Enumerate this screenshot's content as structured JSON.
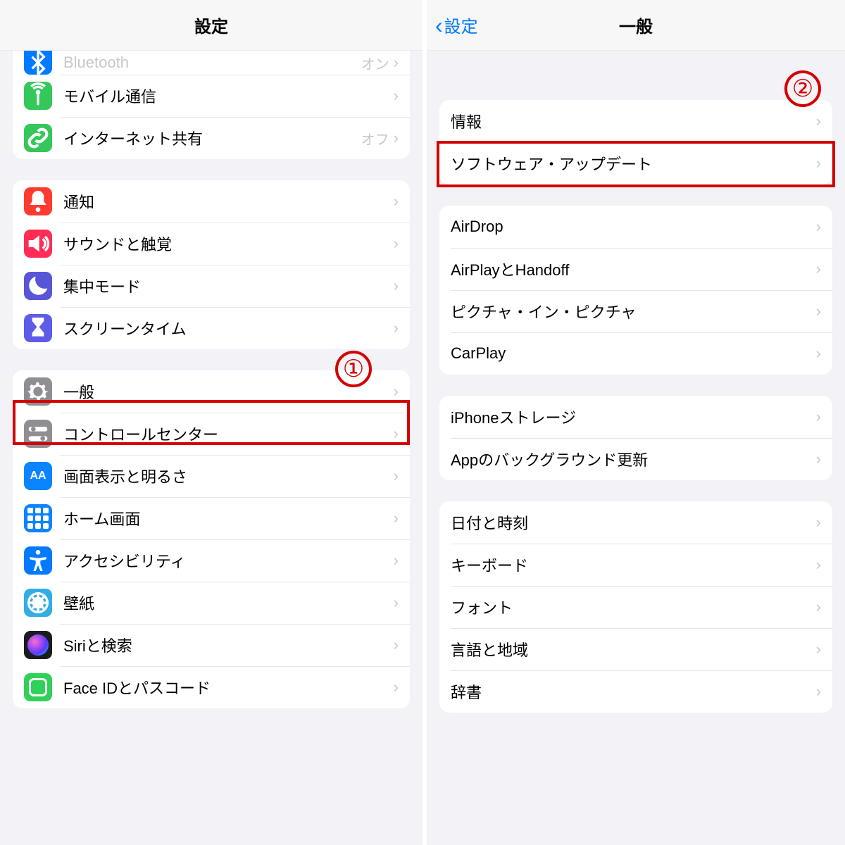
{
  "left": {
    "title": "設定",
    "step_badge": "①",
    "groups": [
      {
        "rows": [
          {
            "icon": "bluetooth-icon",
            "iconClass": "ic-blue",
            "label": "Bluetooth",
            "detail": "オン"
          },
          {
            "icon": "antenna-icon",
            "iconClass": "ic-green",
            "label": "モバイル通信",
            "detail": ""
          },
          {
            "icon": "link-icon",
            "iconClass": "ic-green",
            "label": "インターネット共有",
            "detail": "オフ"
          }
        ]
      },
      {
        "rows": [
          {
            "icon": "bell-icon",
            "iconClass": "ic-red",
            "label": "通知"
          },
          {
            "icon": "speaker-icon",
            "iconClass": "ic-pink",
            "label": "サウンドと触覚"
          },
          {
            "icon": "moon-icon",
            "iconClass": "ic-indigo",
            "label": "集中モード"
          },
          {
            "icon": "hourglass-icon",
            "iconClass": "ic-purple",
            "label": "スクリーンタイム"
          }
        ]
      },
      {
        "rows": [
          {
            "icon": "gear-icon",
            "iconClass": "ic-gray",
            "label": "一般",
            "highlight": true
          },
          {
            "icon": "switches-icon",
            "iconClass": "ic-gray",
            "label": "コントロールセンター"
          },
          {
            "icon": "text-size-icon",
            "iconClass": "ic-darkblue",
            "label": "画面表示と明るさ"
          },
          {
            "icon": "home-grid-icon",
            "iconClass": "ic-darkblue",
            "label": "ホーム画面"
          },
          {
            "icon": "accessibility-icon",
            "iconClass": "ic-blue",
            "label": "アクセシビリティ"
          },
          {
            "icon": "wallpaper-icon",
            "iconClass": "ic-cyan",
            "label": "壁紙"
          },
          {
            "icon": "siri-icon",
            "iconClass": "ic-black",
            "label": "Siriと検索"
          },
          {
            "icon": "faceid-icon",
            "iconClass": "ic-teal",
            "label": "Face IDとパスコード"
          }
        ]
      }
    ]
  },
  "right": {
    "back": "設定",
    "title": "一般",
    "step_badge": "②",
    "groups": [
      {
        "rows": [
          {
            "label": "情報"
          },
          {
            "label": "ソフトウェア・アップデート",
            "highlight": true
          }
        ]
      },
      {
        "rows": [
          {
            "label": "AirDrop"
          },
          {
            "label": "AirPlayとHandoff"
          },
          {
            "label": "ピクチャ・イン・ピクチャ"
          },
          {
            "label": "CarPlay"
          }
        ]
      },
      {
        "rows": [
          {
            "label": "iPhoneストレージ"
          },
          {
            "label": "Appのバックグラウンド更新"
          }
        ]
      },
      {
        "rows": [
          {
            "label": "日付と時刻"
          },
          {
            "label": "キーボード"
          },
          {
            "label": "フォント"
          },
          {
            "label": "言語と地域"
          },
          {
            "label": "辞書"
          }
        ]
      }
    ]
  }
}
